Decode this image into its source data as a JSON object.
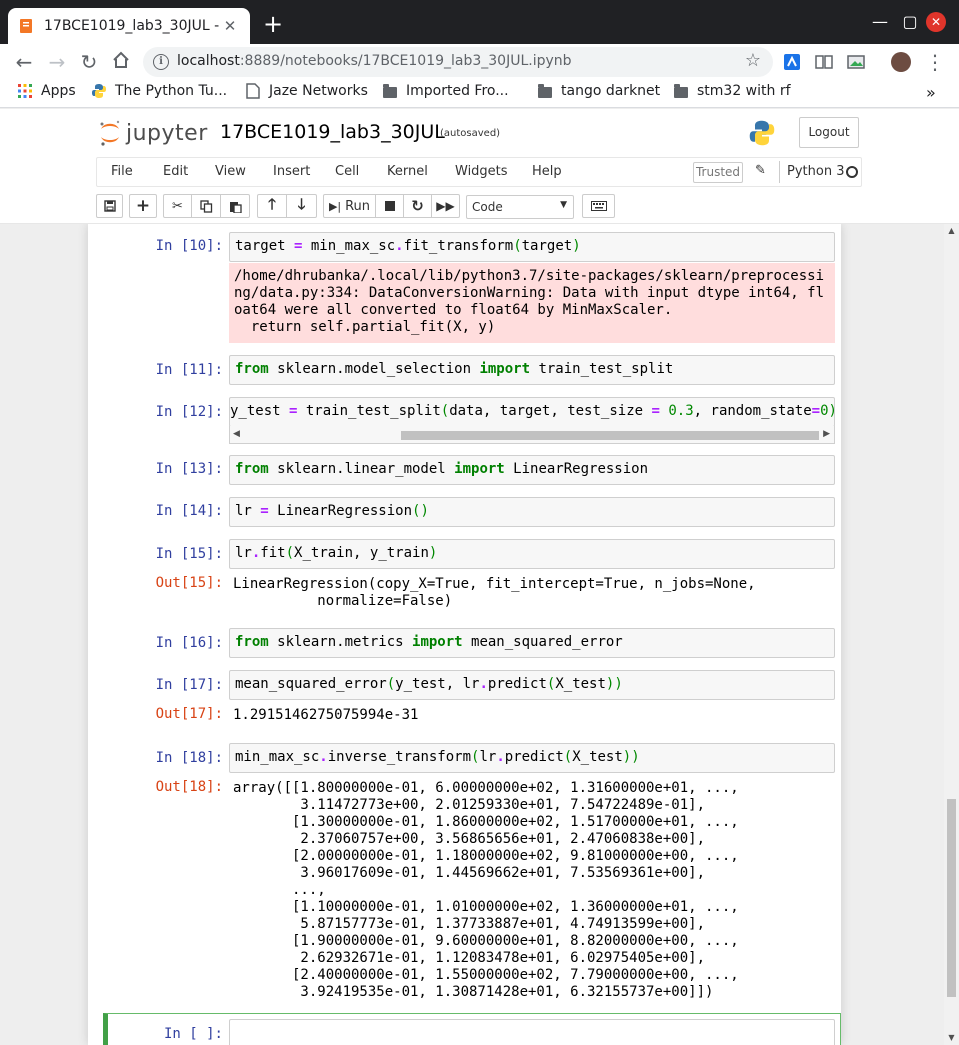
{
  "browser": {
    "tab_title": "17BCE1019_lab3_30JUL -",
    "tab_close": "✕",
    "new_tab": "+",
    "window_controls": {
      "minimize": "—",
      "restore": "▢",
      "close": "✕"
    },
    "url_host": "localhost",
    "url_rest": ":8889/notebooks/17BCE1019_lab3_30JUL.ipynb",
    "star": "☆",
    "menu": "⋮",
    "bookmarks": [
      {
        "label": "Apps",
        "icon": "apps-grid-icon"
      },
      {
        "label": "The Python Tu...",
        "icon": "python-icon"
      },
      {
        "label": "Jaze Networks",
        "icon": "page-icon"
      },
      {
        "label": "Imported Fro...",
        "icon": "folder-icon"
      },
      {
        "label": "tango darknet",
        "icon": "folder-icon"
      },
      {
        "label": "stm32 with rf",
        "icon": "folder-icon"
      }
    ],
    "bookmarks_overflow": "»"
  },
  "jupyter": {
    "logo_text": "jupyter",
    "notebook_name": "17BCE1019_lab3_30JUL",
    "autosaved": "(autosaved)",
    "logout": "Logout",
    "menu": [
      "File",
      "Edit",
      "View",
      "Insert",
      "Cell",
      "Kernel",
      "Widgets",
      "Help"
    ],
    "trusted": "Trusted",
    "kernel": "Python 3",
    "toolbar": {
      "run": "Run",
      "cell_type": "Code"
    }
  },
  "cells": {
    "c10": {
      "prompt": "In [10]:"
    },
    "c10_err": "/home/dhrubanka/.local/lib/python3.7/site-packages/sklearn/preprocessi\nng/data.py:334: DataConversionWarning: Data with input dtype int64, fl\noat64 were all converted to float64 by MinMaxScaler.\n  return self.partial_fit(X, y)",
    "c11": {
      "prompt": "In [11]:"
    },
    "c12": {
      "prompt": "In [12]:"
    },
    "c13": {
      "prompt": "In [13]:"
    },
    "c14": {
      "prompt": "In [14]:"
    },
    "c15": {
      "prompt": "In [15]:",
      "out_prompt": "Out[15]:",
      "output": "LinearRegression(copy_X=True, fit_intercept=True, n_jobs=None,\n          normalize=False)"
    },
    "c16": {
      "prompt": "In [16]:"
    },
    "c17": {
      "prompt": "In [17]:",
      "out_prompt": "Out[17]:",
      "output": "1.2915146275075994e-31"
    },
    "c18": {
      "prompt": "In [18]:",
      "out_prompt": "Out[18]:",
      "output": "array([[1.80000000e-01, 6.00000000e+02, 1.31600000e+01, ...,\n        3.11472773e+00, 2.01259330e+01, 7.54722489e-01],\n       [1.30000000e-01, 1.86000000e+02, 1.51700000e+01, ...,\n        2.37060757e+00, 3.56865656e+01, 2.47060838e+00],\n       [2.00000000e-01, 1.18000000e+02, 9.81000000e+00, ...,\n        3.96017609e-01, 1.44569662e+01, 7.53569361e+00],\n       ...,\n       [1.10000000e-01, 1.01000000e+02, 1.36000000e+01, ...,\n        5.87157773e-01, 1.37733887e+01, 4.74913599e+00],\n       [1.90000000e-01, 9.60000000e+01, 8.82000000e+00, ...,\n        2.62932671e-01, 1.12083478e+01, 6.02975405e+00],\n       [2.40000000e-01, 1.55000000e+02, 7.79000000e+00, ...,\n        3.92419535e-01, 1.30871428e+01, 6.32155737e+00]])"
    },
    "c_new": {
      "prompt": "In [ ]:"
    }
  }
}
